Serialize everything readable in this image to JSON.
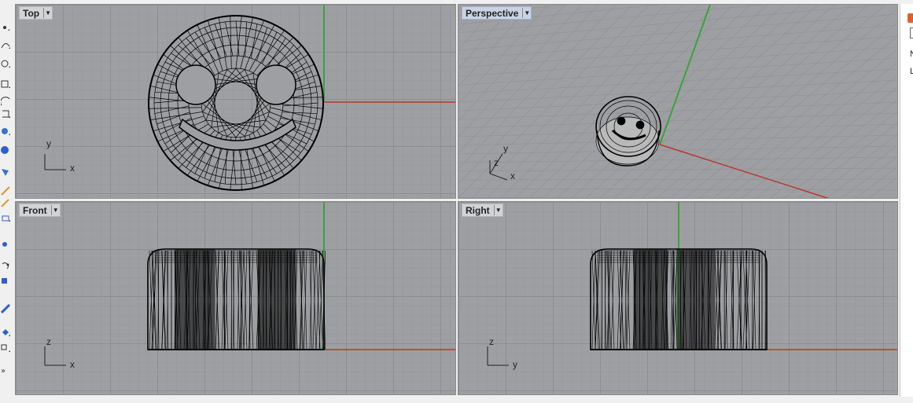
{
  "viewports": {
    "top": {
      "label": "Top"
    },
    "persp": {
      "label": "Perspective"
    },
    "front": {
      "label": "Front"
    },
    "right": {
      "label": "Right"
    }
  },
  "axes": {
    "top": {
      "v": "y",
      "h": "x"
    },
    "persp": {
      "v": "y",
      "z": "z",
      "h": "x"
    },
    "front": {
      "v": "z",
      "h": "x"
    },
    "right": {
      "v": "z",
      "h": "y"
    }
  },
  "viewport_menu_icon": "dropdown-arrow-icon",
  "toolbar": {
    "tools": [
      "point-icon",
      "curve-icon",
      "circle-icon",
      "arc-icon",
      "rectangle-icon",
      "polygon-icon",
      "curve-tools-icon",
      "surface-icon",
      "solid-icon",
      "mesh-icon",
      "transform-icon",
      "dimension-icon",
      "analyze-icon",
      "render-icon",
      "drafting-icon",
      "edit-icon",
      "block-icon"
    ],
    "more_label": "»"
  },
  "right_panel": {
    "items": [
      "N",
      "L"
    ]
  },
  "colors": {
    "viewport_bg": "#9e9fa2",
    "x_axis": "#b53a2e",
    "y_axis": "#3aa33a",
    "wire": "#000000",
    "active_label": "#c9d3e3"
  }
}
